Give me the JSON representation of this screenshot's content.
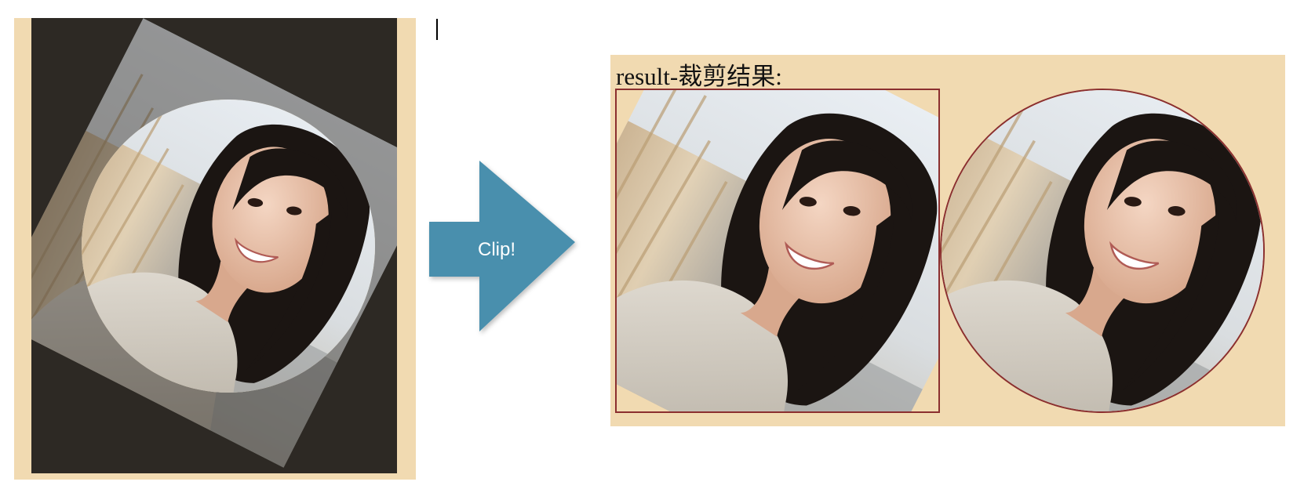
{
  "arrow": {
    "label": "Clip!"
  },
  "result": {
    "title": "result-裁剪结果:"
  },
  "colors": {
    "panel_bg": "#f1dab1",
    "dark_bg": "#2d2924",
    "arrow_fill": "#4a8fad",
    "result_border": "#8b2f2f"
  },
  "icons": {
    "arrow": "arrow-right-icon"
  }
}
